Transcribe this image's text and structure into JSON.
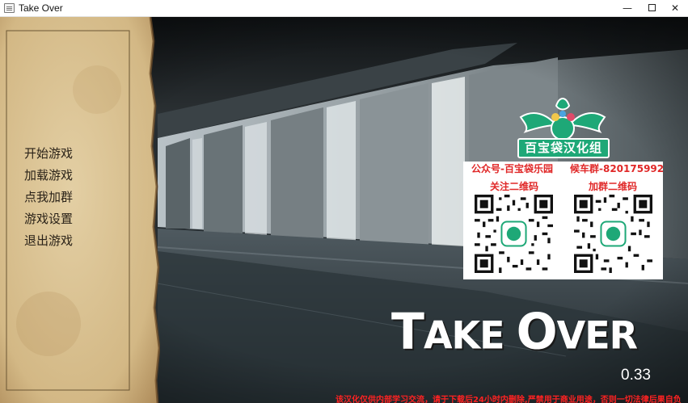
{
  "window": {
    "title": "Take Over",
    "minimize_glyph": "—",
    "close_glyph": "✕"
  },
  "menu": {
    "items": [
      {
        "label": "开始游戏"
      },
      {
        "label": "加载游戏"
      },
      {
        "label": "点我加群"
      },
      {
        "label": "游戏设置"
      },
      {
        "label": "退出游戏"
      }
    ]
  },
  "promo": {
    "logo_text": "百宝袋汉化组",
    "left_title": "公众号-百宝袋乐园",
    "left_subtitle": "关注二维码",
    "right_title": "候车群-820175992",
    "right_subtitle": "加群二维码"
  },
  "game_title": {
    "word1_big": "T",
    "word1_rest": "AKE ",
    "word2_big": "O",
    "word2_rest": "VER",
    "version": "0.33"
  },
  "disclaimer": "该汉化仅供内部学习交流，请于下载后24小时内删除,严禁用于商业用途，否则一切法律后果自负",
  "colors": {
    "accent_red": "#e02828",
    "logo_green": "#1ea877",
    "parchment": "#d8c39a",
    "menu_text": "#2a2218"
  }
}
